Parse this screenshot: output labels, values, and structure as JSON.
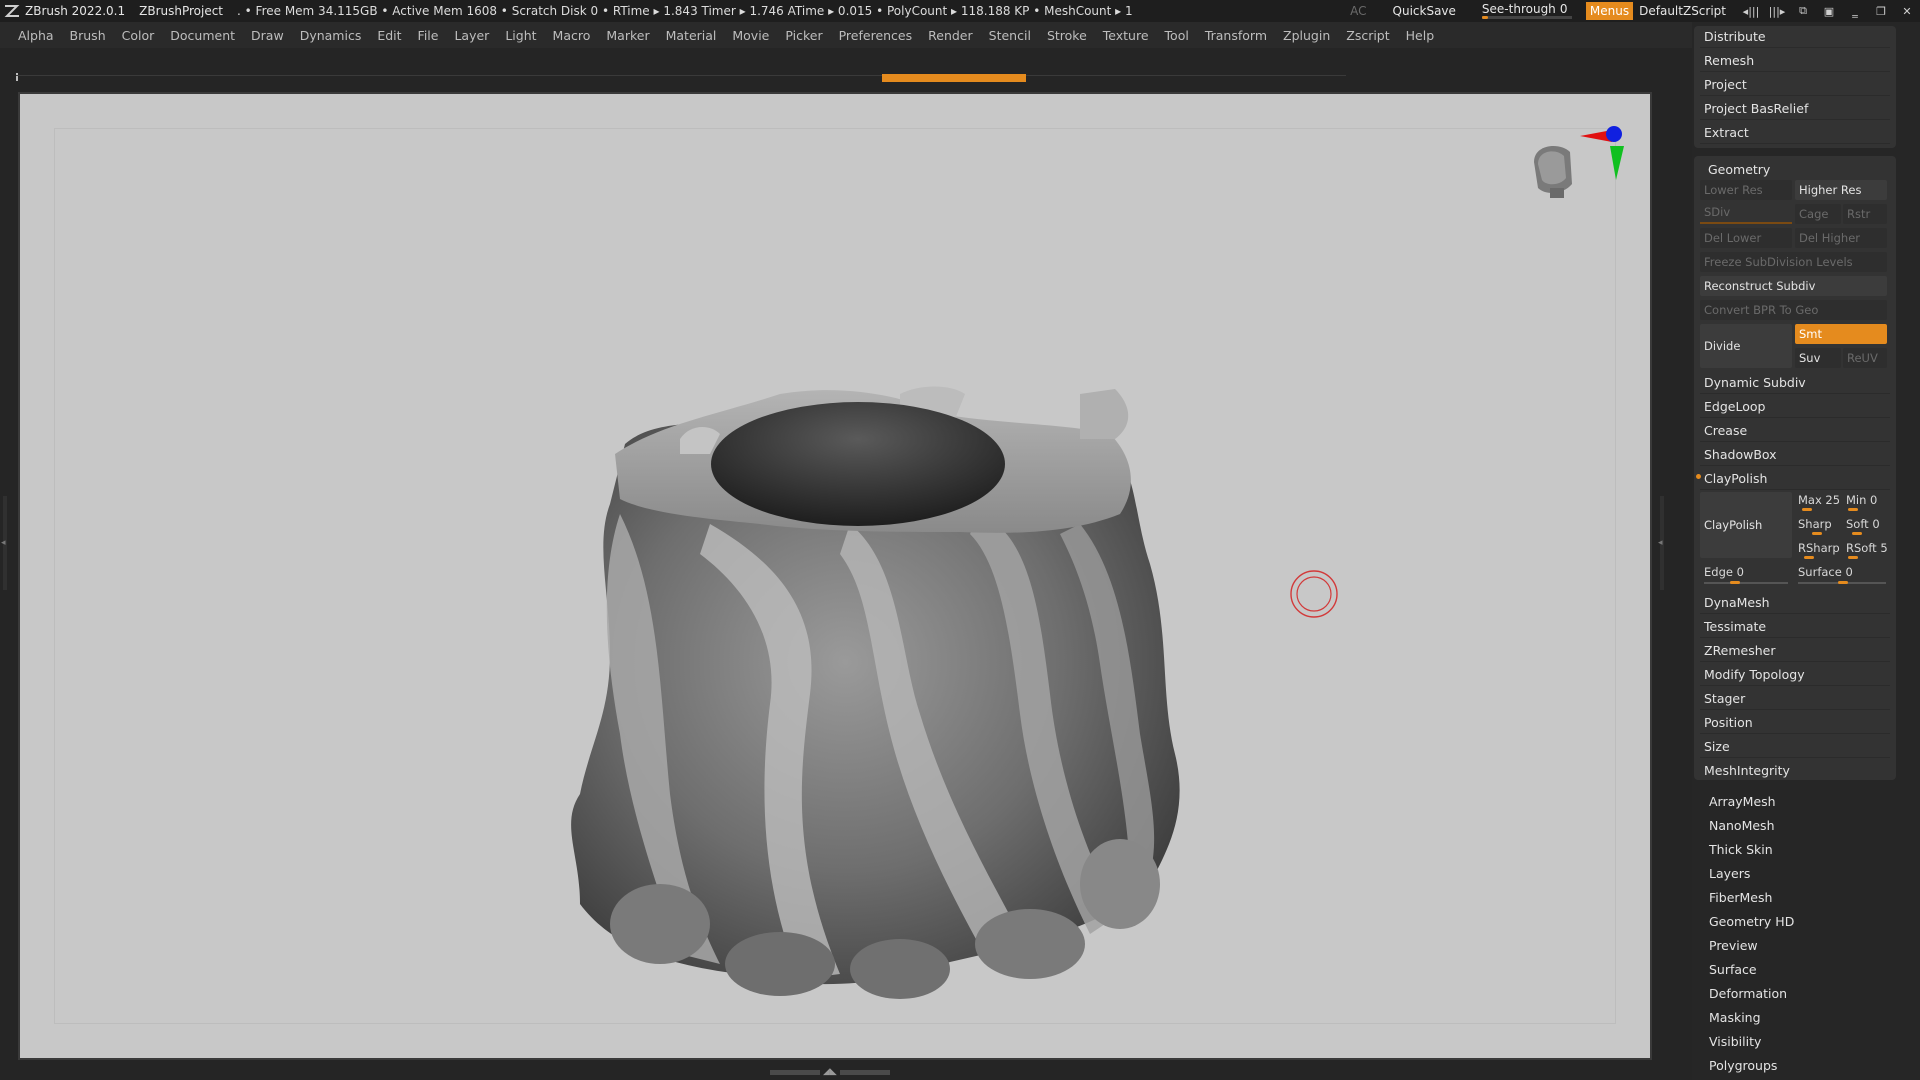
{
  "titlebar": {
    "app": "ZBrush 2022.0.1",
    "project": "ZBrushProject",
    "stats": ". • Free Mem 34.115GB • Active Mem 1608 • Scratch Disk 0 •  RTime ▸ 1.843 Timer ▸ 1.746 ATime ▸ 0.015 • PolyCount ▸ 118.188 KP  • MeshCount ▸ 1",
    "ac": "AC",
    "quicksave": "QuickSave",
    "see_through_label": "See-through",
    "see_through_value": "0",
    "menus": "Menus",
    "script": "DefaultZScript"
  },
  "menu": [
    "Alpha",
    "Brush",
    "Color",
    "Document",
    "Draw",
    "Dynamics",
    "Edit",
    "File",
    "Layer",
    "Light",
    "Macro",
    "Marker",
    "Material",
    "Movie",
    "Picker",
    "Preferences",
    "Render",
    "Stencil",
    "Stroke",
    "Texture",
    "Tool",
    "Transform",
    "Zplugin",
    "Zscript",
    "Help"
  ],
  "top_group": [
    "Distribute",
    "Remesh",
    "Project",
    "Project BasRelief",
    "Extract"
  ],
  "geometry": {
    "title": "Geometry",
    "lower_res": "Lower Res",
    "higher_res": "Higher Res",
    "sdiv": "SDiv",
    "cage": "Cage",
    "rstr": "Rstr",
    "del_lower": "Del Lower",
    "del_higher": "Del Higher",
    "freeze": "Freeze SubDivision Levels",
    "reconstruct": "Reconstruct Subdiv",
    "convert": "Convert BPR To Geo",
    "divide": "Divide",
    "smt": "Smt",
    "suv": "Suv",
    "reuv": "ReUV",
    "items_a": [
      "Dynamic Subdiv",
      "EdgeLoop",
      "Crease",
      "ShadowBox"
    ],
    "claypolish": "ClayPolish",
    "claypolish_btn": "ClayPolish",
    "max": "Max 25",
    "min": "Min 0",
    "sharp": "Sharp",
    "soft": "Soft 0",
    "rsharp": "RSharp",
    "rsoft": "RSoft 5",
    "edge": "Edge 0",
    "surface": "Surface 0",
    "items_b": [
      "DynaMesh",
      "Tessimate",
      "ZRemesher",
      "Modify Topology",
      "Stager",
      "Position",
      "Size",
      "MeshIntegrity"
    ]
  },
  "subpalettes": [
    "ArrayMesh",
    "NanoMesh",
    "Thick Skin",
    "Layers",
    "FiberMesh",
    "Geometry HD",
    "Preview",
    "Surface",
    "Deformation",
    "Masking",
    "Visibility",
    "Polygroups"
  ],
  "colors": {
    "accent": "#e58b1e",
    "viewport_bg": "#c8c8c8"
  },
  "icons": [
    "zbrush-logo-icon",
    "dock-left-icon",
    "dock-right-icon",
    "layout-icon",
    "window-icon",
    "minimize-icon",
    "restore-icon",
    "close-icon",
    "axis-gizmo-icon",
    "head-gizmo-icon",
    "brush-cursor-icon"
  ]
}
